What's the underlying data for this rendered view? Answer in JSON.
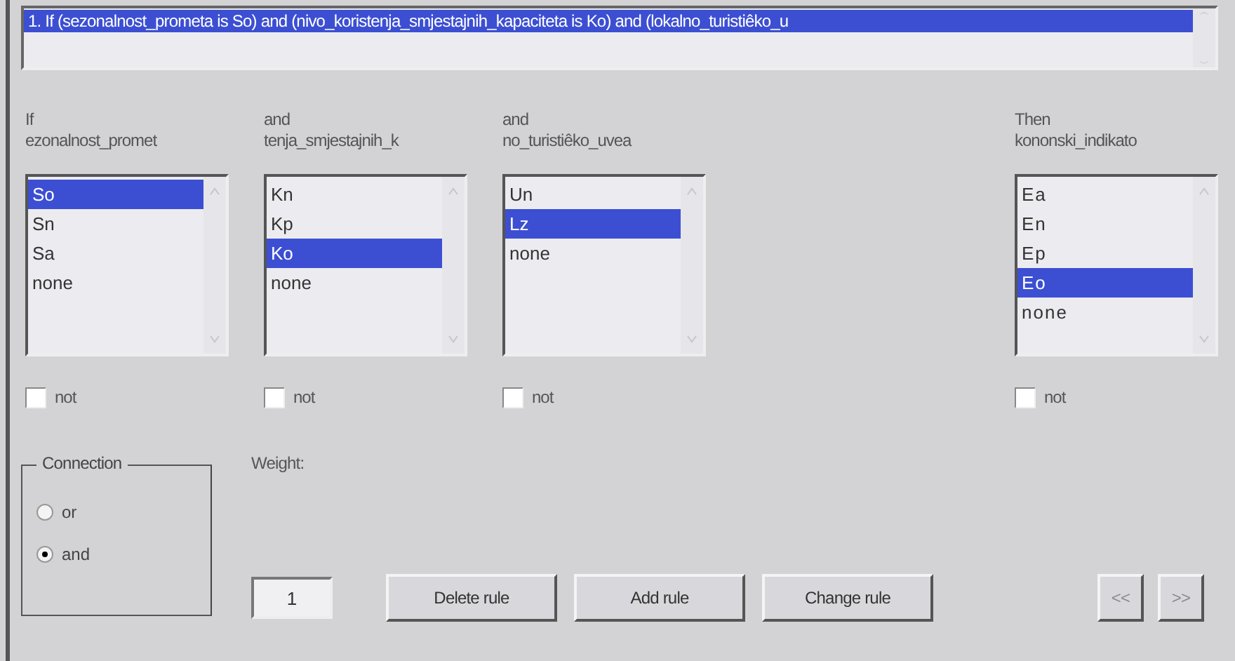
{
  "rule_list": {
    "rules": [
      {
        "text": "1. If (sezonalnost_prometa is So) and (nivo_koristenja_smjestajnih_kapaciteta is Ko) and (lokalno_turistiêko_u",
        "selected": true
      }
    ]
  },
  "columns": [
    {
      "kind": "input",
      "heading": "If",
      "variable": "ezonalnost_promet",
      "not": false,
      "not_label": "not",
      "options": [
        {
          "label": "So",
          "selected": true
        },
        {
          "label": "Sn",
          "selected": false
        },
        {
          "label": "Sa",
          "selected": false
        },
        {
          "label": "none",
          "selected": false
        }
      ]
    },
    {
      "kind": "input",
      "heading": "and",
      "variable": "tenja_smjestajnih_k",
      "not": false,
      "not_label": "not",
      "options": [
        {
          "label": "Kn",
          "selected": false
        },
        {
          "label": "Kp",
          "selected": false
        },
        {
          "label": "Ko",
          "selected": true
        },
        {
          "label": "none",
          "selected": false
        }
      ]
    },
    {
      "kind": "input",
      "heading": "and",
      "variable": "no_turistiêko_uvea",
      "not": false,
      "not_label": "not",
      "options": [
        {
          "label": "Un",
          "selected": false
        },
        {
          "label": "Lz",
          "selected": true
        },
        {
          "label": "none",
          "selected": false
        }
      ]
    },
    {
      "kind": "output",
      "heading": "Then",
      "variable": "kononski_indikato",
      "not": false,
      "not_label": "not",
      "options": [
        {
          "label": "Ea",
          "selected": false
        },
        {
          "label": "En",
          "selected": false
        },
        {
          "label": "Ep",
          "selected": false
        },
        {
          "label": "Eo",
          "selected": true
        },
        {
          "label": "none",
          "selected": false
        }
      ]
    }
  ],
  "connection": {
    "title": "Connection",
    "options": [
      {
        "label": "or",
        "selected": false
      },
      {
        "label": "and",
        "selected": true
      }
    ]
  },
  "weight": {
    "label": "Weight:",
    "value": "1"
  },
  "buttons": [
    "Delete rule",
    "Add rule",
    "Change rule"
  ],
  "nav_buttons": [
    {
      "label": "<<",
      "disabled": true
    },
    {
      "label": ">>",
      "disabled": true
    }
  ]
}
